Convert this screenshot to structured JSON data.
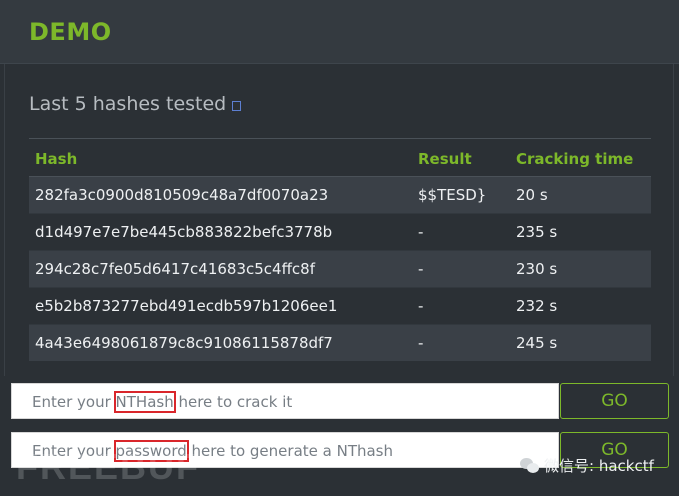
{
  "header": {
    "title": "DEMO"
  },
  "section": {
    "title": "Last 5 hashes tested",
    "info_icon": "info-icon"
  },
  "table": {
    "columns": [
      "Hash",
      "Result",
      "Cracking time"
    ],
    "rows": [
      {
        "hash": "282fa3c0900d810509c48a7df0070a23",
        "result": "$$TESD}",
        "time": "20 s"
      },
      {
        "hash": "d1d497e7e7be445cb883822befc3778b",
        "result": "-",
        "time": "235 s"
      },
      {
        "hash": "294c28c7fe05d6417c41683c5c4ffc8f",
        "result": "-",
        "time": "230 s"
      },
      {
        "hash": "e5b2b873277ebd491ecdb597b1206ee1",
        "result": "-",
        "time": "232 s"
      },
      {
        "hash": "4a43e6498061879c8c91086115878df7",
        "result": "-",
        "time": "245 s"
      }
    ]
  },
  "crack_form": {
    "placeholder_pre": "Enter your ",
    "placeholder_highlight": "NTHash",
    "placeholder_post": " here to crack it",
    "button": "GO"
  },
  "generate_form": {
    "placeholder_pre": "Enter your ",
    "placeholder_highlight": "password",
    "placeholder_post": " here to generate a NThash",
    "button": "GO"
  },
  "watermark": {
    "left": "FREEBUF",
    "right": "微信号: hackctf"
  },
  "colors": {
    "accent": "#7db82a",
    "highlight_box": "#d9262b",
    "background": "#2b3035"
  }
}
